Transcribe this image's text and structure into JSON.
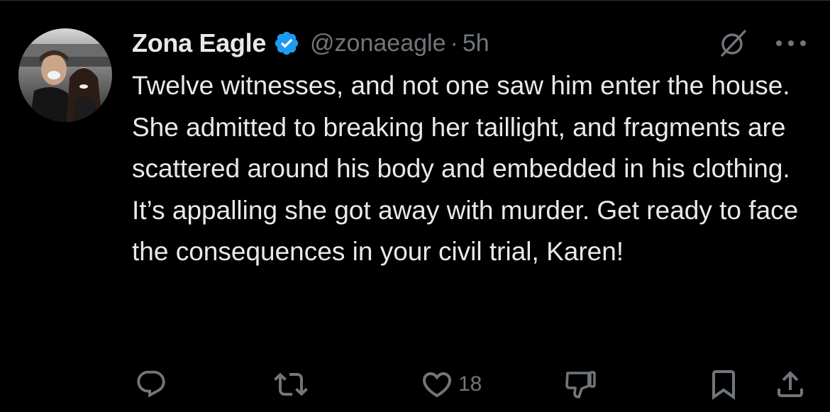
{
  "tweet": {
    "author": {
      "display_name": "Zona Eagle",
      "handle": "@zonaeagle",
      "separator": "·",
      "time": "5h",
      "verified": true
    },
    "text": "Twelve witnesses, and not one saw him enter the house. She admitted to breaking her taillight, and fragments are scattered around his body and embedded in his clothing. It’s appalling she got away with murder. Get ready to face the consequences in your civil trial, Karen!",
    "header_icons": [
      "grok-icon",
      "more-icon"
    ],
    "actions": {
      "reply": {
        "icon": "reply-icon",
        "count": ""
      },
      "repost": {
        "icon": "repost-icon",
        "count": ""
      },
      "like": {
        "icon": "heart-icon",
        "count": "18"
      },
      "dislike": {
        "icon": "dislike-icon",
        "count": ""
      },
      "bookmark": {
        "icon": "bookmark-icon",
        "count": ""
      },
      "share": {
        "icon": "share-icon",
        "count": ""
      }
    }
  },
  "colors": {
    "background": "#000000",
    "primary_text": "#e7e9ea",
    "secondary_text": "#71767b",
    "verified_blue": "#1d9bf0",
    "divider": "#2f3336"
  }
}
